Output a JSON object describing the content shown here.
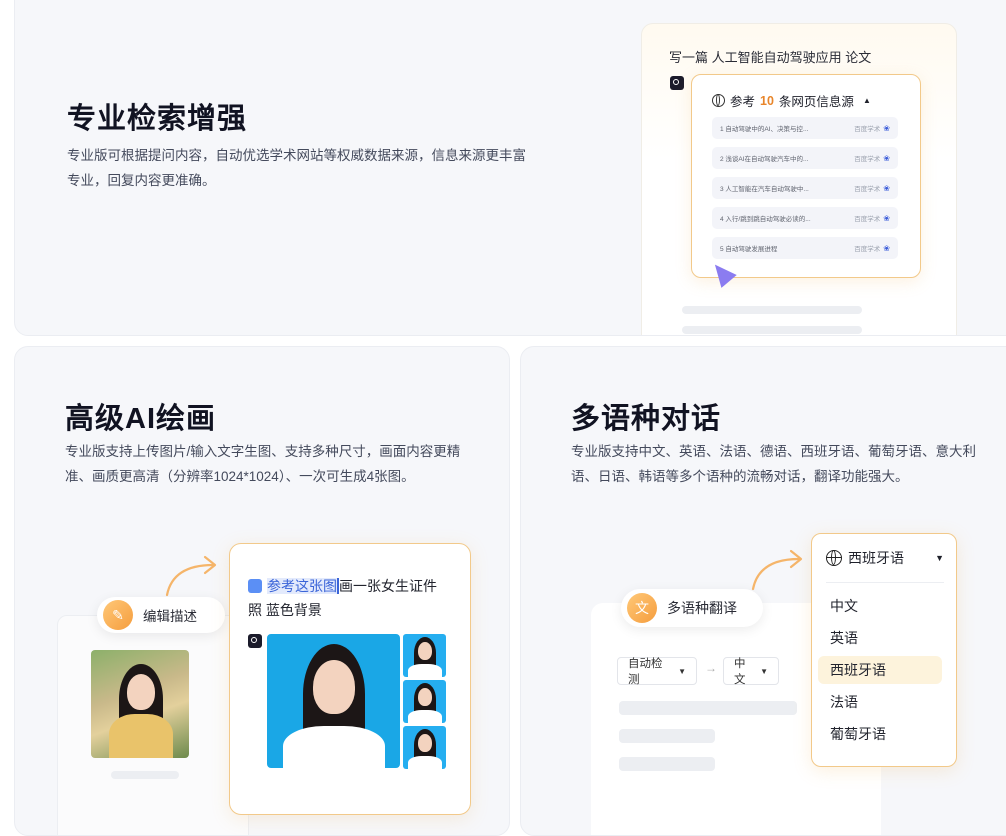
{
  "search": {
    "title": "专业检索增强",
    "desc": "专业版可根据提问内容，自动优选学术网站等权威数据来源，信息来源更丰富专业，回复内容更准确。",
    "prompt": "写一篇 人工智能自动驾驶应用 论文",
    "refs_prefix": "参考",
    "refs_count": "10",
    "refs_suffix": "条网页信息源",
    "refs_caret": "▲",
    "refs": [
      {
        "text": "1 自动驾驶中的AI、决策与控...",
        "source": "百度学术"
      },
      {
        "text": "2 浅谈AI在自动驾驶汽车中的...",
        "source": "百度学术"
      },
      {
        "text": "3 人工智能在汽车自动驾驶中...",
        "source": "百度学术"
      },
      {
        "text": "4 入行/跳到跳自动驾驶必读的...",
        "source": "百度学术"
      },
      {
        "text": "5 自动驾驶发展进程",
        "source": "百度学术"
      }
    ]
  },
  "draw": {
    "title": "高级AI绘画",
    "desc": "专业版支持上传图片/输入文字生图、支持多种尺寸，画面内容更精准、画质更高清（分辨率1024*1024）、一次可生成4张图。",
    "edit_label": "编辑描述",
    "prompt_highlight": "参考这张图",
    "prompt_rest": "画一张女生证件照 蓝色背景"
  },
  "lang": {
    "title": "多语种对话",
    "desc": "专业版支持中文、英语、法语、德语、西班牙语、葡萄牙语、意大利语、日语、韩语等多个语种的流畅对话，翻译功能强大。",
    "translate_label": "多语种翻译",
    "source_lang": "自动检测",
    "target_lang": "中文",
    "arrow": "→",
    "dropdown_selected": "西班牙语",
    "options": [
      "中文",
      "英语",
      "西班牙语",
      "法语",
      "葡萄牙语"
    ]
  },
  "colors": {
    "accent": "#f2c98a",
    "highlight": "#3a64d8",
    "ref_count": "#e8852a"
  }
}
